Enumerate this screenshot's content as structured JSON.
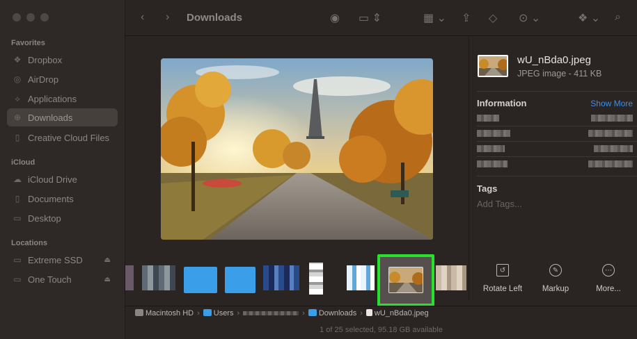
{
  "window": {
    "title": "Downloads"
  },
  "sidebar": {
    "sections": [
      {
        "label": "Favorites",
        "items": [
          {
            "label": "Dropbox",
            "icon": "dropbox-icon"
          },
          {
            "label": "AirDrop",
            "icon": "airdrop-icon"
          },
          {
            "label": "Applications",
            "icon": "applications-icon"
          },
          {
            "label": "Downloads",
            "icon": "downloads-icon",
            "active": true
          },
          {
            "label": "Creative Cloud Files",
            "icon": "document-icon"
          }
        ]
      },
      {
        "label": "iCloud",
        "items": [
          {
            "label": "iCloud Drive",
            "icon": "cloud-icon"
          },
          {
            "label": "Documents",
            "icon": "document-icon"
          },
          {
            "label": "Desktop",
            "icon": "desktop-icon"
          }
        ]
      },
      {
        "label": "Locations",
        "items": [
          {
            "label": "Extreme SSD",
            "icon": "drive-icon"
          },
          {
            "label": "One Touch",
            "icon": "drive-icon"
          }
        ]
      }
    ]
  },
  "info": {
    "file_name": "wU_nBda0.jpeg",
    "file_kind": "JPEG image - 411 KB",
    "information_label": "Information",
    "show_more": "Show More",
    "tags_label": "Tags",
    "tags_placeholder": "Add Tags...",
    "actions": [
      {
        "label": "Rotate Left",
        "icon": "rotate-left-icon"
      },
      {
        "label": "Markup",
        "icon": "markup-icon"
      },
      {
        "label": "More...",
        "icon": "more-icon"
      }
    ]
  },
  "pathbar": {
    "items": [
      "Macintosh HD",
      "Users",
      "Downloads",
      "wU_nBda0.jpeg"
    ]
  },
  "status": "1 of 25 selected, 95.18 GB available",
  "colors": {
    "accent": "#3b8ff0",
    "selection": "#27e22c"
  }
}
